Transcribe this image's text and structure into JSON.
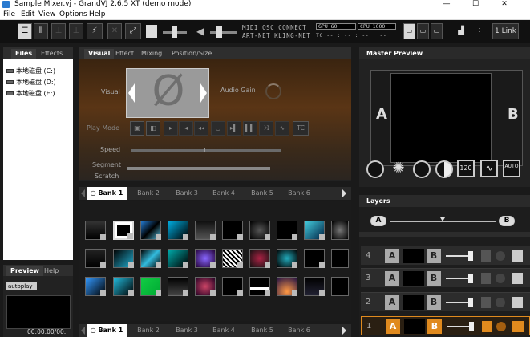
{
  "window": {
    "title": "Sample Mixer.vj - GrandVJ 2.6.5 XT (demo mode)",
    "minimize": "—",
    "maximize": "☐",
    "close": "✕"
  },
  "menu": [
    "File",
    "Edit",
    "View",
    "Options",
    "Help"
  ],
  "toolbar": {
    "protocols_line1": "MIDI  OSC  CONNECT",
    "protocols_line2": "ART-NET KLING-NET",
    "gpu": "GPU 60",
    "cpu": "CPU 1000",
    "tc": "TC -- : -- : -- . --",
    "link": "1 Link"
  },
  "browser": {
    "tabs": [
      "Files",
      "Effects"
    ],
    "drives": [
      "本地磁盘 (C:)",
      "本地磁盘 (D:)",
      "本地磁盘 (E:)"
    ]
  },
  "preview": {
    "tabs": [
      "Preview",
      "Help"
    ],
    "autoplay": "autoplay",
    "time": "00:00:00/00:"
  },
  "visual": {
    "tabs": [
      "Visual",
      "Effect",
      "Mixing",
      "Position/Size"
    ],
    "visual_label": "Visual",
    "audio_gain_label": "Audio Gain",
    "play_mode_label": "Play Mode",
    "speed_label": "Speed",
    "segment_label": "Segment",
    "scratch_label": "Scratch",
    "empty_symbol": "Ø",
    "tc_button": "TC"
  },
  "banks_top": [
    "Bank 1",
    "Bank 2",
    "Bank 3",
    "Bank 4",
    "Bank 5",
    "Bank 6"
  ],
  "banks_bottom": [
    "Bank 1",
    "Bank 2",
    "Bank 3",
    "Bank 4",
    "Bank 5",
    "Bank 6"
  ],
  "master": {
    "title": "Master Preview",
    "a_label": "A",
    "b_label": "B",
    "bpm": "120",
    "auto": "AUTO"
  },
  "layers": {
    "title": "Layers",
    "crossfade_a": "A",
    "crossfade_b": "B",
    "rows": [
      {
        "num": "4",
        "a": "A",
        "b": "B"
      },
      {
        "num": "3",
        "a": "A",
        "b": "B"
      },
      {
        "num": "2",
        "a": "A",
        "b": "B"
      },
      {
        "num": "1",
        "a": "A",
        "b": "B"
      }
    ]
  }
}
